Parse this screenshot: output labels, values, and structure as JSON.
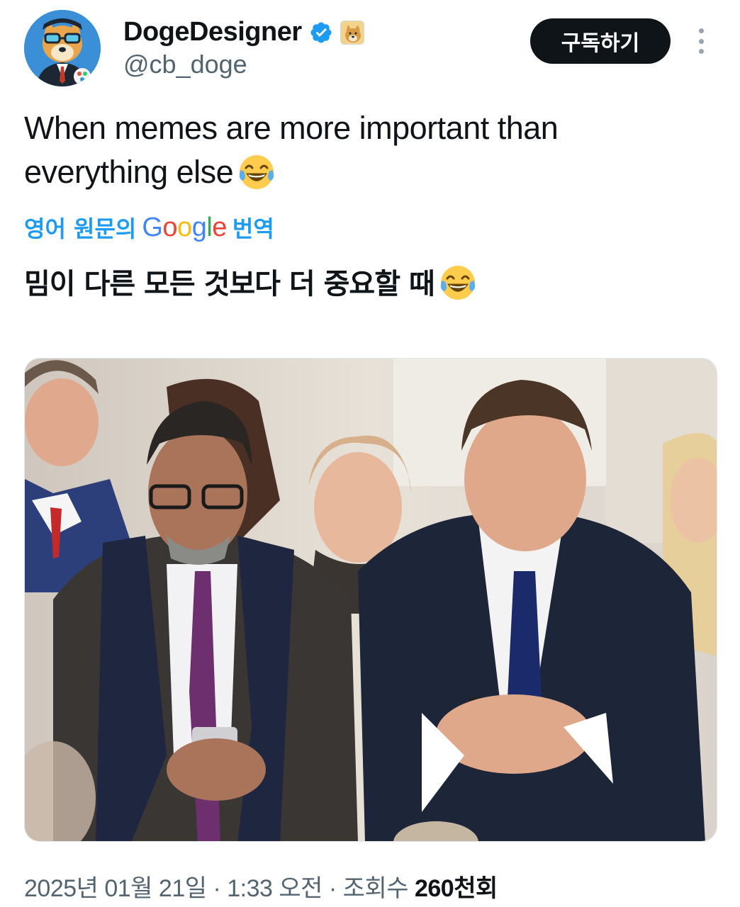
{
  "author": {
    "display_name": "DogeDesigner",
    "handle": "@cb_doge",
    "avatar_icon": "doge-avatar-icon",
    "verified_icon": "verified-badge-icon",
    "affiliation_icon": "doge-affiliation-icon",
    "verified_color": "#1d9bf0"
  },
  "actions": {
    "subscribe_label": "구독하기",
    "more_icon": "more-options-icon"
  },
  "tweet": {
    "text_line1": "When memes are more important than",
    "text_line2": "everything else",
    "emoji": "tears-of-joy-emoji",
    "translate_prefix": "영어 원문의",
    "translate_brand": "Google",
    "translate_suffix": "번역",
    "translated_text": "밈이 다른 모든 것보다 더 중요할 때"
  },
  "media": {
    "type": "photo",
    "icon": "photo-icon"
  },
  "meta": {
    "date": "2025년 01월 21일",
    "separator": "·",
    "time": "1:33 오전",
    "views_label": "조회수",
    "views_count": "260천회"
  },
  "colors": {
    "link_blue": "#1d9bf0",
    "text_primary": "#0f1419",
    "text_secondary": "#536471",
    "button_dark": "#0f1419"
  }
}
